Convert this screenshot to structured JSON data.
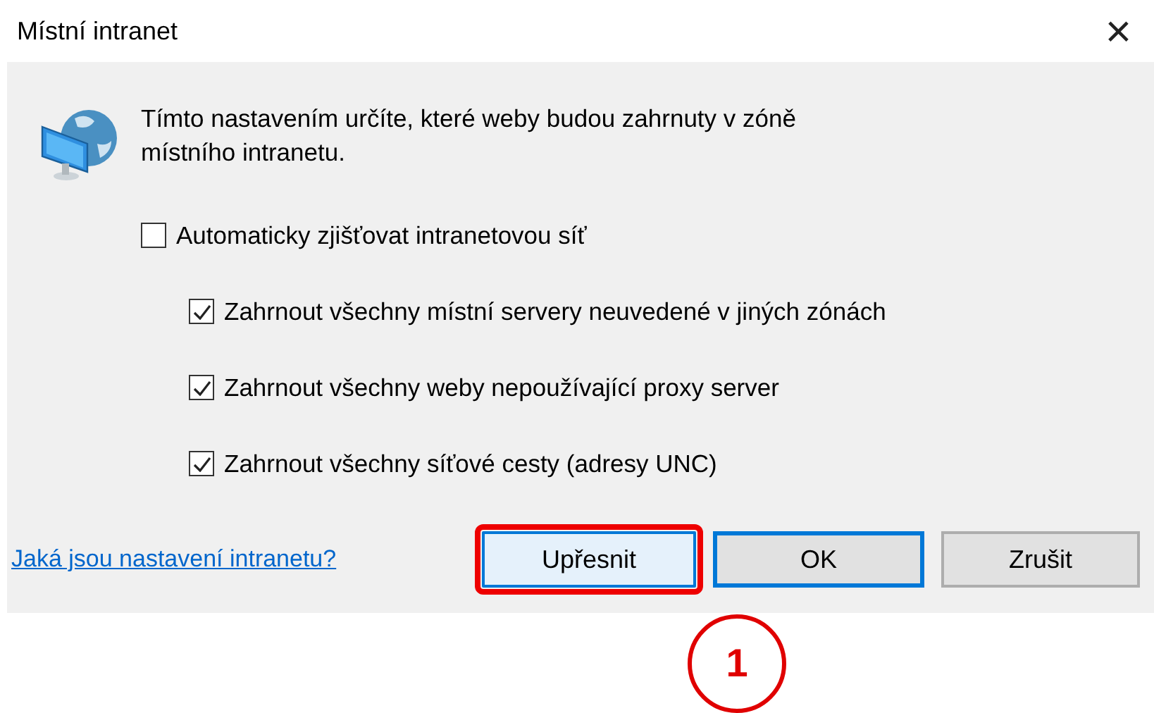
{
  "window": {
    "title": "Místní intranet",
    "close": "×"
  },
  "description": "Tímto nastavením určíte, které weby budou zahrnuty v zóně místního intranetu.",
  "options": [
    {
      "label": "Automaticky zjišťovat intranetovou síť",
      "checked": false,
      "children": [
        {
          "label": "Zahrnout všechny místní servery neuvedené v jiných zónách",
          "checked": true
        },
        {
          "label": "Zahrnout všechny weby nepoužívající proxy server",
          "checked": true
        },
        {
          "label": "Zahrnout všechny síťové cesty (adresy UNC)",
          "checked": true
        }
      ]
    }
  ],
  "help_link": "Jaká jsou nastavení intranetu?",
  "buttons": [
    {
      "label": "Upřesnit",
      "hovered": true,
      "default": false,
      "highlighted": true
    },
    {
      "label": "OK",
      "hovered": false,
      "default": true,
      "highlighted": false
    },
    {
      "label": "Zrušit",
      "hovered": false,
      "default": false,
      "highlighted": false
    }
  ],
  "annotation": {
    "label": "1"
  }
}
